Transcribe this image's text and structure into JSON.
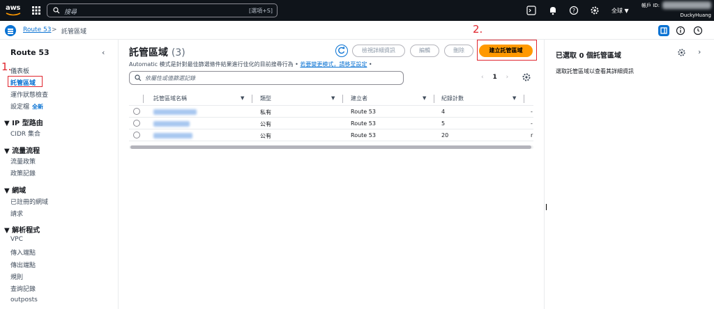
{
  "topnav": {
    "logo": "aws",
    "search_placeholder": "搜尋",
    "search_shortcut": "[選項+S]",
    "region": "全球 ▼",
    "account_label": "帳戶 ID:",
    "username": "DuckyHuang"
  },
  "breadcrumb": {
    "service": "Route 53",
    "separator": ">",
    "current": "託管區域"
  },
  "sidebar": {
    "title": "Route 53",
    "collapse": "‹",
    "items": [
      {
        "label": "儀表板"
      },
      {
        "label": "託管區域",
        "active": true
      },
      {
        "label": "運作狀態檢查"
      },
      {
        "label": "設定檔",
        "badge": "全新"
      }
    ],
    "groups": [
      {
        "title": "▼  IP 型路由",
        "items": [
          "CIDR 集合"
        ]
      },
      {
        "title": "▼  流量流程",
        "items": [
          "流量政策",
          "政策記錄"
        ]
      },
      {
        "title": "▼  網域",
        "items": [
          "已註冊的網域",
          "請求"
        ]
      },
      {
        "title": "▼  解析程式",
        "items": [
          "VPC",
          "傳入端點",
          "傳出端點",
          "規則",
          "查詢記錄",
          "outposts"
        ]
      }
    ]
  },
  "annotations": {
    "step1": "1.",
    "step2": "2."
  },
  "main": {
    "title": "託管區域",
    "count": "(3)",
    "buttons": {
      "view_details": "檢視詳細資訊",
      "edit": "編輯",
      "delete": "刪除",
      "create": "建立託管區域"
    },
    "description_prefix": "Automatic 模式是針對最佳篩選條件結果進行佳化的目前搜尋行為 •",
    "description_link1": "若要變更模式，請移至設定",
    "description_suffix": " •",
    "filter_placeholder": "依屬性或值篩選記錄",
    "page_number": "1",
    "columns": [
      "託管區域名稱",
      "類型",
      "建立者",
      "紀錄計數"
    ],
    "rows": [
      {
        "type": "私有",
        "created_by": "Route 53",
        "records": "4",
        "extra": "-"
      },
      {
        "type": "公有",
        "created_by": "Route 53",
        "records": "5",
        "extra": "-"
      },
      {
        "type": "公有",
        "created_by": "Route 53",
        "records": "20",
        "extra": "r"
      }
    ]
  },
  "rpanel": {
    "title": "已選取 0 個託管區域",
    "subtitle": "選取託管區域以查看其詳細資訊",
    "chevron": "›"
  },
  "colors": {
    "accent": "#0972d3",
    "primary_button": "#ff9900",
    "topnav_bg": "#0f141a",
    "annotation": "#e0252e"
  }
}
